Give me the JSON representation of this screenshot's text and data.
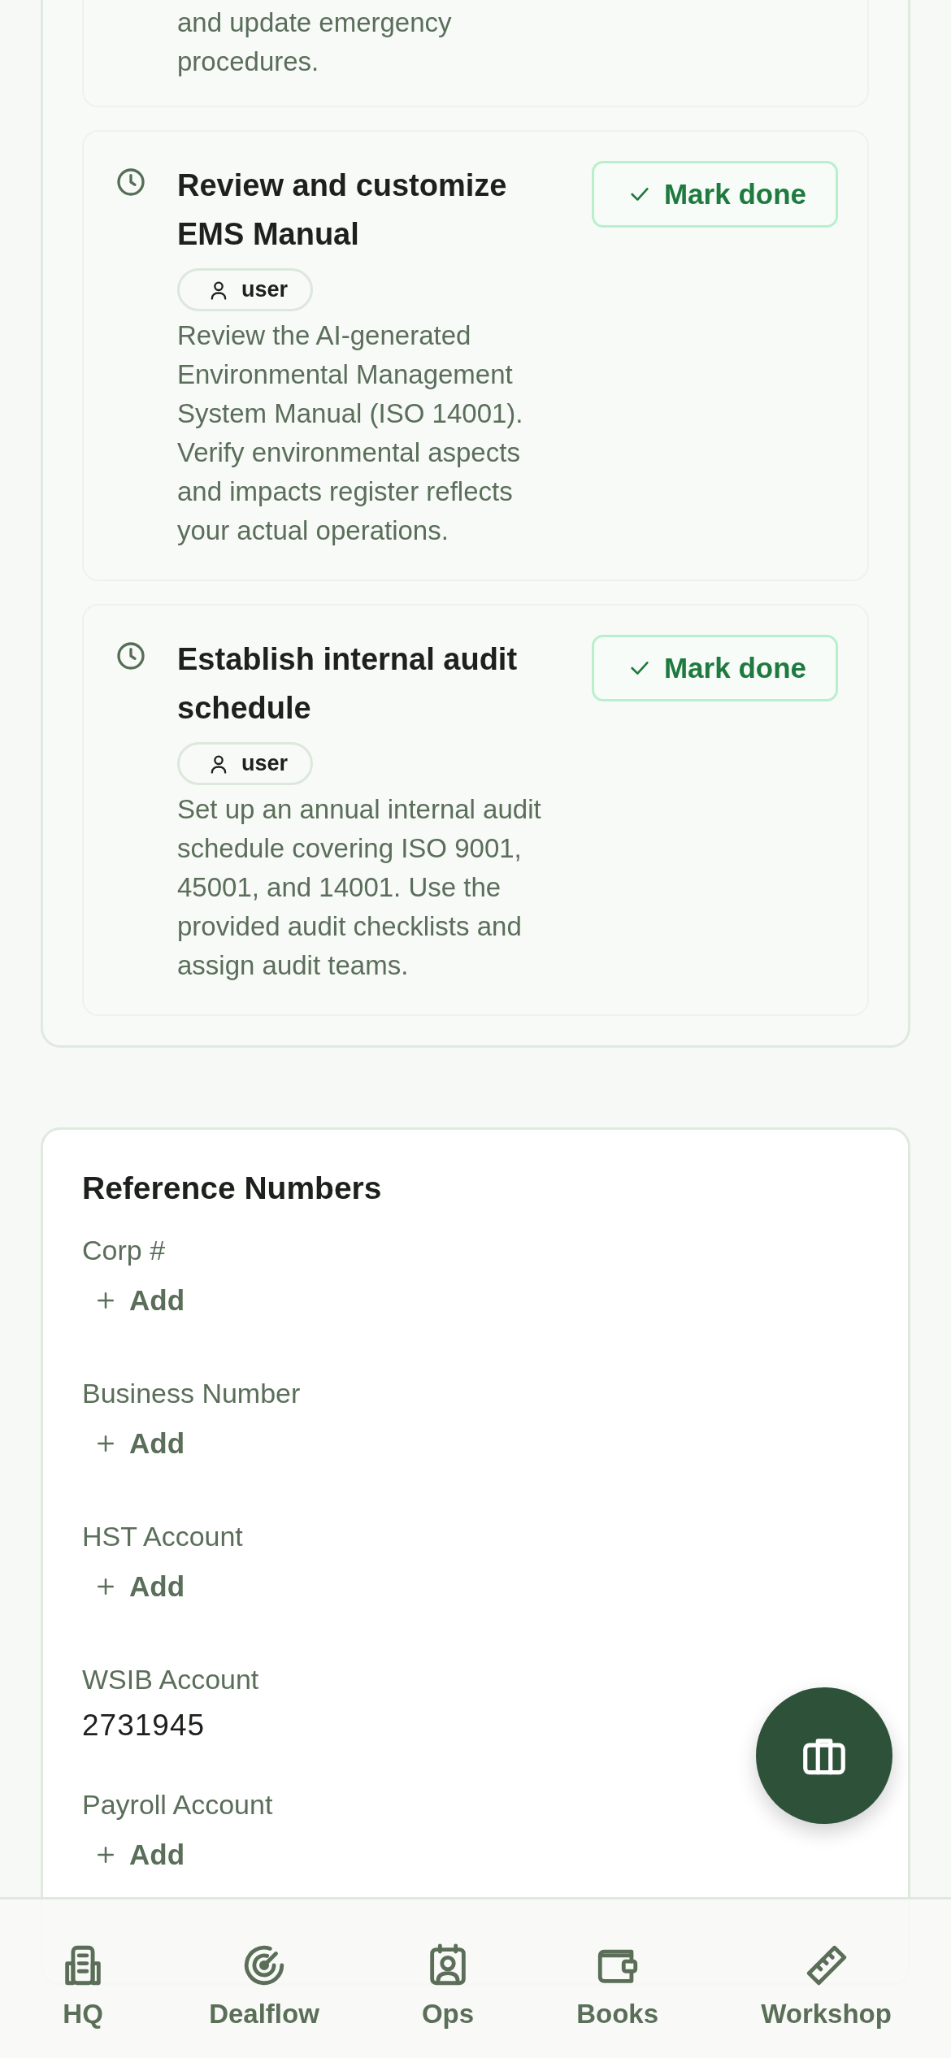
{
  "tasks": {
    "partial_task": {
      "description": "and update emergency procedures."
    },
    "items": [
      {
        "done": false,
        "title": "Review and customize EMS Manual",
        "assignee": "user",
        "description": "Review the AI-generated Environmental Management System Manual (ISO 14001). Verify environmental aspects and impacts register reflects your actual operations.",
        "action": "Mark done"
      },
      {
        "done": false,
        "title": "Establish internal audit schedule",
        "assignee": "user",
        "description": "Set up an annual internal audit schedule covering ISO 9001, 45001, and 14001. Use the provided audit checklists and assign audit teams.",
        "action": "Mark done"
      }
    ]
  },
  "reference_numbers": {
    "title": "Reference Numbers",
    "fields": [
      {
        "label": "Corp #",
        "kind": "empty",
        "action": "Add"
      },
      {
        "label": "Business Number",
        "kind": "empty",
        "action": "Add"
      },
      {
        "label": "HST Account",
        "kind": "empty",
        "action": "Add"
      },
      {
        "label": "WSIB Account",
        "kind": "filled",
        "value": "2731945"
      },
      {
        "label": "Payroll Account",
        "kind": "empty",
        "action": "Add"
      }
    ]
  },
  "bottom_nav": [
    {
      "label": "HQ"
    },
    {
      "label": "Dealflow"
    },
    {
      "label": "Ops"
    },
    {
      "label": "Books"
    },
    {
      "label": "Workshop"
    }
  ]
}
